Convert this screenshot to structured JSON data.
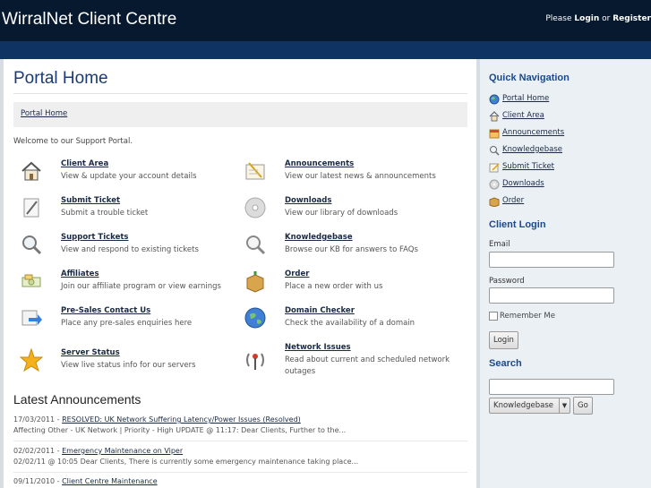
{
  "header": {
    "logo": "WirralNet Client Centre",
    "prefix": "Please",
    "login": "Login",
    "or": "or",
    "register": "Register"
  },
  "main": {
    "title": "Portal Home",
    "breadcrumb": "Portal Home",
    "welcome": "Welcome to our Support Portal.",
    "tiles": [
      {
        "title": "Client Area",
        "desc": "View & update your account details",
        "icon": "home-icon"
      },
      {
        "title": "Announcements",
        "desc": "View our latest news & announcements",
        "icon": "notepad-icon"
      },
      {
        "title": "Submit Ticket",
        "desc": "Submit a trouble ticket",
        "icon": "pencil-paper-icon"
      },
      {
        "title": "Downloads",
        "desc": "View our library of downloads",
        "icon": "disc-icon"
      },
      {
        "title": "Support Tickets",
        "desc": "View and respond to existing tickets",
        "icon": "magnifier-icon"
      },
      {
        "title": "Knowledgebase",
        "desc": "Browse our KB for answers to FAQs",
        "icon": "magnifier-icon"
      },
      {
        "title": "Affiliates",
        "desc": "Join our affiliate program or view earnings",
        "icon": "money-icon"
      },
      {
        "title": "Order",
        "desc": "Place a new order with us",
        "icon": "box-icon"
      },
      {
        "title": "Pre-Sales Contact Us",
        "desc": "Place any pre-sales enquiries here",
        "icon": "forward-arrow-icon"
      },
      {
        "title": "Domain Checker",
        "desc": "Check the availability of a domain",
        "icon": "globe-icon"
      },
      {
        "title": "Server Status",
        "desc": "View live status info for our servers",
        "icon": "star-icon"
      },
      {
        "title": "Network Issues",
        "desc": "Read about current and scheduled network outages",
        "icon": "antenna-icon"
      }
    ],
    "announcements_title": "Latest Announcements",
    "announcements": [
      {
        "date": "17/03/2011 -",
        "link": "RESOLVED: UK Network Suffering Latency/Power Issues (Resolved)",
        "excerpt": "Affecting Other - UK Network | Priority - High UPDATE @ 11:17: Dear Clients, Further to the..."
      },
      {
        "date": "02/02/2011 -",
        "link": "Emergency Maintenance on Viper",
        "excerpt": "02/02/11 @ 10:05 Dear Clients,   There is currently some emergency maintenance taking place..."
      },
      {
        "date": "09/11/2010 -",
        "link": "Client Centre Maintenance",
        "excerpt": ""
      }
    ]
  },
  "sidebar": {
    "quick_nav_title": "Quick Navigation",
    "nav": [
      {
        "label": "Portal Home",
        "icon": "globe-icon"
      },
      {
        "label": "Client Area",
        "icon": "home-icon"
      },
      {
        "label": "Announcements",
        "icon": "calendar-icon"
      },
      {
        "label": "Knowledgebase",
        "icon": "magnifier-icon"
      },
      {
        "label": "Submit Ticket",
        "icon": "edit-icon"
      },
      {
        "label": "Downloads",
        "icon": "disc-icon"
      },
      {
        "label": "Order",
        "icon": "box-icon"
      }
    ],
    "login_title": "Client Login",
    "email_label": "Email",
    "password_label": "Password",
    "remember_label": "Remember Me",
    "login_button": "Login",
    "search_title": "Search",
    "search_select": "Knowledgebase",
    "go_button": "Go"
  }
}
